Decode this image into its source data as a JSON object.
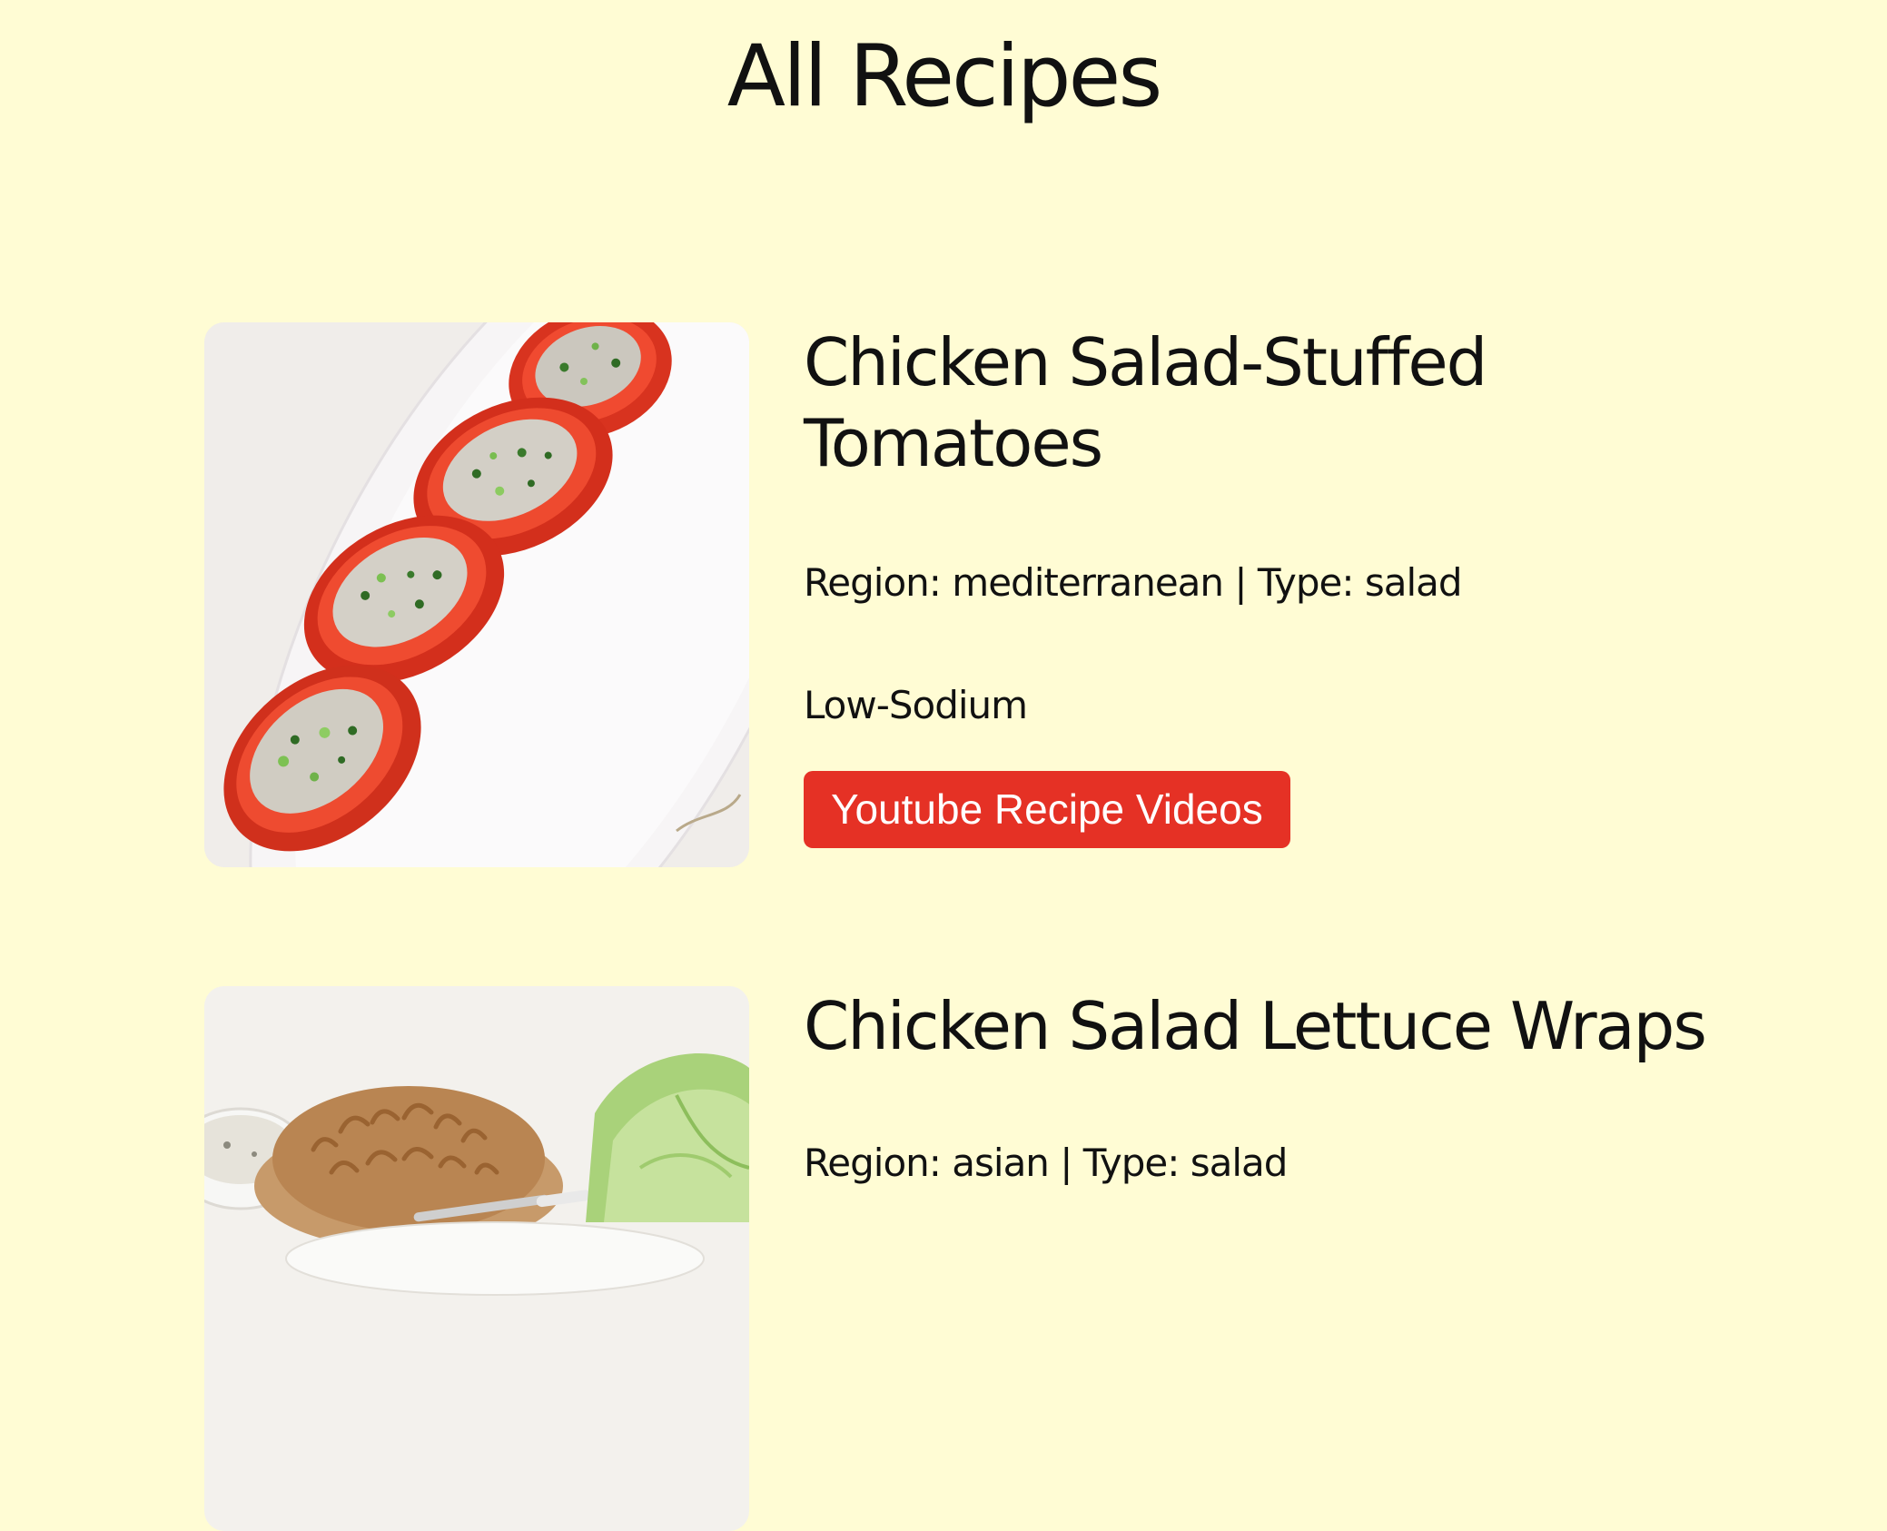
{
  "page": {
    "title": "All Recipes",
    "background_color": "#FFFCD4"
  },
  "recipes": [
    {
      "title": "Chicken Salad-Stuffed Tomatoes",
      "meta": "Region: mediterranean | Type: salad",
      "diet": "Low-Sodium",
      "video_button_label": "Youtube Recipe Videos",
      "image_alt": "Chicken salad stuffed into halved tomatoes on a white plate"
    },
    {
      "title": "Chicken Salad Lettuce Wraps",
      "meta": "Region: asian | Type: salad",
      "image_alt": "Crispy noodles and lettuce leaves for chicken salad wraps"
    }
  ],
  "colors": {
    "button": "#E53125",
    "button_text": "#FFFFFF",
    "text": "#111111"
  }
}
